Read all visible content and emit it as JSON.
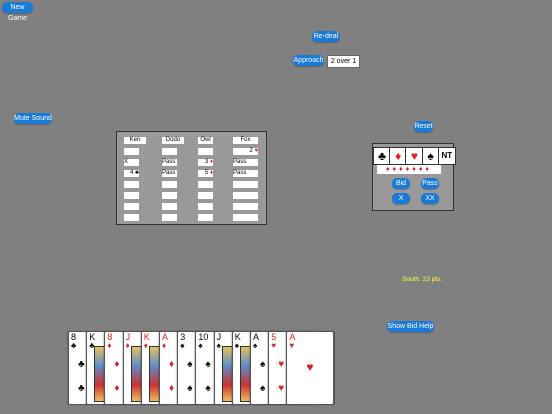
{
  "toolbar": {
    "new_game": "New Game",
    "redeal": "Re-deal",
    "approach_label": "Approach",
    "approach_value": "2 over 1",
    "mute": "Mute Sound",
    "reset": "Reset",
    "show_help": "Show Bid Help"
  },
  "bidding": {
    "players": [
      "Ken",
      "Dodo",
      "Owl",
      "Fox"
    ],
    "rows": [
      [
        {
          "text": ""
        },
        {
          "text": ""
        },
        {
          "text": ""
        },
        {
          "text": "2",
          "suit": "♥",
          "red": true
        }
      ],
      [
        {
          "text": "X"
        },
        {
          "text": "Pass"
        },
        {
          "text": "3",
          "suit": "♦",
          "red": true
        },
        {
          "text": "Pass"
        }
      ],
      [
        {
          "text": "4",
          "suit": "♣",
          "red": false
        },
        {
          "text": "Pass"
        },
        {
          "text": "5",
          "suit": "♦",
          "red": true
        },
        {
          "text": "Pass"
        }
      ],
      [
        {
          "text": ""
        },
        {
          "text": ""
        },
        {
          "text": ""
        },
        {
          "text": ""
        }
      ],
      [
        {
          "text": ""
        },
        {
          "text": ""
        },
        {
          "text": ""
        },
        {
          "text": ""
        }
      ],
      [
        {
          "text": ""
        },
        {
          "text": ""
        },
        {
          "text": ""
        },
        {
          "text": ""
        }
      ],
      [
        {
          "text": ""
        },
        {
          "text": ""
        },
        {
          "text": ""
        },
        {
          "text": ""
        }
      ]
    ]
  },
  "bid_box": {
    "suits": [
      {
        "symbol": "♣",
        "icon": "club-icon",
        "red": false
      },
      {
        "symbol": "♦",
        "icon": "diamond-icon",
        "red": true
      },
      {
        "symbol": "♥",
        "icon": "heart-icon",
        "red": true
      },
      {
        "symbol": "♠",
        "icon": "spade-icon",
        "red": false
      },
      {
        "symbol": "NT",
        "icon": "notrump-label",
        "red": false
      }
    ],
    "levels": "♦♦♦♦♦♦♦",
    "bid": "Bid",
    "pass": "Pass",
    "double": "X",
    "redouble": "XX"
  },
  "score": {
    "south": "South: 23 pts."
  },
  "hand": [
    {
      "rank": "8",
      "suit": "♣",
      "red": false
    },
    {
      "rank": "K",
      "suit": "♣",
      "red": false,
      "face": true
    },
    {
      "rank": "8",
      "suit": "♦",
      "red": true
    },
    {
      "rank": "J",
      "suit": "♦",
      "red": true,
      "face": true
    },
    {
      "rank": "K",
      "suit": "♦",
      "red": true,
      "face": true
    },
    {
      "rank": "A",
      "suit": "♦",
      "red": true
    },
    {
      "rank": "3",
      "suit": "♠",
      "red": false
    },
    {
      "rank": "10",
      "suit": "♠",
      "red": false
    },
    {
      "rank": "J",
      "suit": "♠",
      "red": false,
      "face": true
    },
    {
      "rank": "K",
      "suit": "♠",
      "red": false,
      "face": true
    },
    {
      "rank": "A",
      "suit": "♠",
      "red": false
    },
    {
      "rank": "5",
      "suit": "♥",
      "red": true
    },
    {
      "rank": "A",
      "suit": "♥",
      "red": true
    }
  ],
  "colors": {
    "table_felt": "#808080",
    "button_blue": "#1a7ad8",
    "score_yellow": "#ffff33",
    "red_suit": "#dd2222"
  }
}
